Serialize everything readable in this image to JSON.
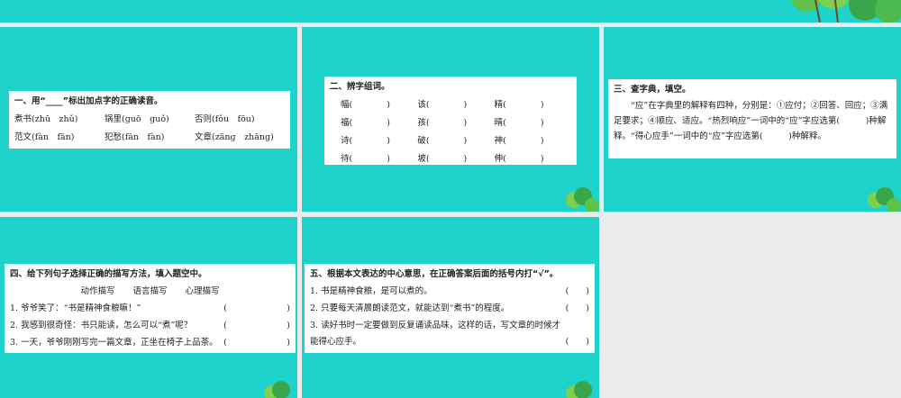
{
  "q1": {
    "title": "一、用“____”标出加点字的正确读音。",
    "items": [
      "煮书(zhū　zhǔ)",
      "锅里(guō　guǒ)",
      "否则(fǒu　fōu)",
      "范文(fàn　fān)",
      "犯愁(fān　fàn)",
      "文章(zāng　zhāng)"
    ]
  },
  "q2": {
    "title": "二、辨字组词。",
    "items": [
      "幅(　　　　)",
      "该(　　　　)",
      "精(　　　　)",
      "福(　　　　)",
      "孩(　　　　)",
      "晴(　　　　)",
      "诗(　　　　)",
      "破(　　　　)",
      "神(　　　　)",
      "待(　　　　)",
      "坡(　　　　)",
      "伸(　　　　)"
    ]
  },
  "q3": {
    "title": "三、查字典，填空。",
    "text": "“应”在字典里的解释有四种，分别是：①应付；②回答、回应；③满足要求；④顺应、适应。“热烈响应”一词中的“应”字应选第(　　　)种解释。“得心应手”一词中的“应”字应选第(　　　)种解释。"
  },
  "q4": {
    "title": "四、给下列句子选择正确的描写方法，填入题空中。",
    "options": [
      "动作描写",
      "语言描写",
      "心理描写"
    ],
    "items": [
      "1. 爷爷笑了：“书是精神食粮嘛！”",
      "2. 我感到很奇怪：书只能读，怎么可以“煮”呢？",
      "3. 一天，爷爷刚刚写完一篇文章，正坐在椅子上品茶。"
    ],
    "blank": "(　　　　　　　)"
  },
  "q5": {
    "title": "五、根据本文表达的中心意思，在正确答案后面的括号内打“√”。",
    "items": [
      "1. 书是精神食粮，是可以煮的。",
      "2. 只要每天清晨朗读范文，就能达到“煮书”的程度。",
      "3. 读好书时一定要做到反复诵读品味，这样的话，写文章的时候才能得心应手。"
    ],
    "blank": "(　　)"
  }
}
